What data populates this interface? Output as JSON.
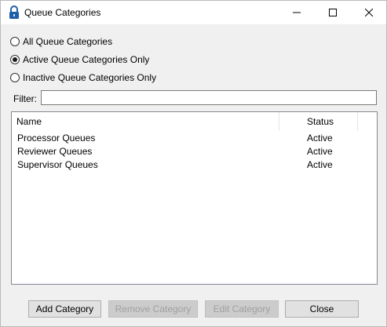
{
  "window": {
    "title": "Queue Categories",
    "icon": "padlock-icon"
  },
  "filter_options": [
    {
      "label": "All Queue Categories",
      "checked": false
    },
    {
      "label": "Active Queue Categories Only",
      "checked": true
    },
    {
      "label": "Inactive Queue Categories Only",
      "checked": false
    }
  ],
  "filter": {
    "label": "Filter:",
    "value": "",
    "placeholder": ""
  },
  "list": {
    "columns": [
      "Name",
      "Status"
    ],
    "rows": [
      {
        "name": "Processor Queues",
        "status": "Active"
      },
      {
        "name": "Reviewer Queues",
        "status": "Active"
      },
      {
        "name": "Supervisor Queues",
        "status": "Active"
      }
    ]
  },
  "buttons": {
    "add": {
      "label": "Add Category",
      "enabled": true
    },
    "remove": {
      "label": "Remove Category",
      "enabled": false
    },
    "edit": {
      "label": "Edit Category",
      "enabled": false
    },
    "close": {
      "label": "Close",
      "enabled": true
    }
  },
  "colors": {
    "icon_blue": "#1e5fa8",
    "window_bg": "#f0f0f0",
    "disabled_text": "#a0a0a0"
  }
}
